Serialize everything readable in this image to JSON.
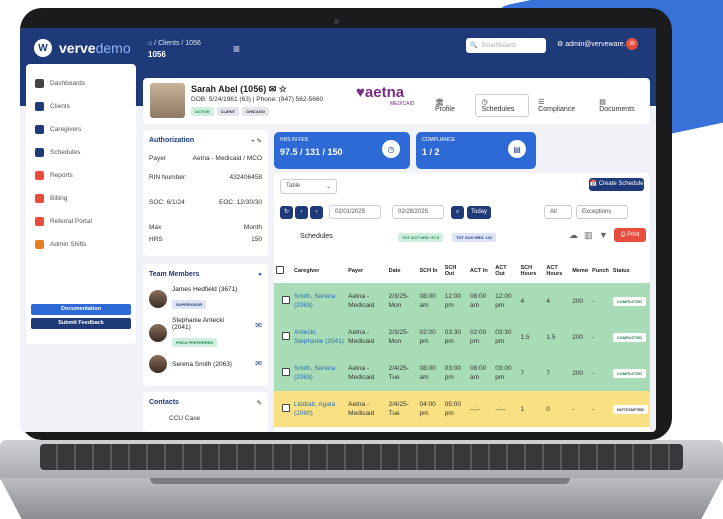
{
  "brand": {
    "verve": "verve",
    "demo": "demo"
  },
  "header": {
    "breadcrumb": "⌂ / Clients / 1056",
    "client_id": "1056",
    "search_placeholder": "SmartSearch",
    "user": "admin@verveware.co",
    "notif_count": "99"
  },
  "sidebar": {
    "items": [
      {
        "label": "Dashboards",
        "color": "#444"
      },
      {
        "label": "Clients",
        "color": "#1f3a78"
      },
      {
        "label": "Caregivers",
        "color": "#1f3a78"
      },
      {
        "label": "Schedules",
        "color": "#1f3a78"
      },
      {
        "label": "Reports",
        "color": "#e74c3c"
      },
      {
        "label": "Billing",
        "color": "#e74c3c"
      },
      {
        "label": "Referral Portal",
        "color": "#e74c3c"
      },
      {
        "label": "Admin Shifts",
        "color": "#e67e22"
      }
    ],
    "documentation": "Documentation",
    "feedback": "Submit Feedback"
  },
  "client": {
    "name": "Sarah Abel (1056)",
    "dob": "DOB: 5/24/1961 (63) | Phone: (847) 562-5660",
    "tags": [
      "ACTIVE",
      "CLIENT",
      "CHICAGO"
    ],
    "payer_logo": "♥aetna",
    "payer_sub": "MEDICAID",
    "tabs": [
      "Profile",
      "Schedules",
      "Compliance",
      "Documents"
    ]
  },
  "authorization": {
    "title": "Authorization",
    "payer_label": "Payer",
    "payer": "Aetna - Medicaid / MCO",
    "rin_label": "RIN Number:",
    "rin": "432406458",
    "soc": "SOC: 6/1/24",
    "eoc": "EOC: 12/30/30",
    "max_label": "Max",
    "max_val": "Month",
    "hrs_label": "HRS",
    "hrs_val": "150"
  },
  "team": {
    "title": "Team Members",
    "members": [
      {
        "name": "James Hedfield (3671)",
        "tag": "SUPERVISOR"
      },
      {
        "name": "Stephanie Antecki (2041)",
        "tag": "FMCA PREFERRED"
      },
      {
        "name": "Serena Smith (2063)",
        "tag": ""
      }
    ]
  },
  "contacts": {
    "title": "Contacts",
    "first": "CCU Case"
  },
  "stats": [
    {
      "label": "HRS IN FEB",
      "value": "97.5 / 131 / 150"
    },
    {
      "label": "COMPLIANCE",
      "value": "1 / 2"
    }
  ],
  "schedule": {
    "table_select": "Table",
    "date_from": "02/01/2025",
    "date_to": "02/28/2025",
    "today": "Today",
    "create": "Create Schedule",
    "all": "All",
    "exceptions": "Exceptions",
    "heading": "Schedules",
    "badge1": "TOT ACT HRS: 97.5",
    "badge2": "TOT SCH HRS: 121",
    "print": "Print",
    "columns": [
      "Caregiver",
      "Payer",
      "Date",
      "SCH In",
      "SCH Out",
      "ACT In",
      "ACT Out",
      "SCH Hours",
      "ACT Hours",
      "Memo",
      "Punch",
      "Status"
    ],
    "rows": [
      {
        "cls": "green",
        "cells": [
          "Smith, Serena (2063)",
          "Aetna - Medicaid",
          "2/3/25- Mon",
          "08:00 am",
          "12:00 pm",
          "08:00 am",
          "12:00 pm",
          "4",
          "4",
          "200",
          "-",
          "COMPLETED"
        ]
      },
      {
        "cls": "green",
        "cells": [
          "Antecki, Stephanie (2041)",
          "Aetna - Medicaid",
          "2/3/25- Mon",
          "02:00 pm",
          "03:30 pm",
          "02:00 pm",
          "03:30 pm",
          "1.5",
          "1.5",
          "200",
          "-",
          "COMPLETED"
        ]
      },
      {
        "cls": "green",
        "cells": [
          "Smith, Serena (2063)",
          "Aetna - Medicaid",
          "2/4/25- Tue",
          "08:00 am",
          "03:00 pm",
          "08:00 am",
          "03:00 pm",
          "7",
          "7",
          "200",
          "-",
          "COMPLETED"
        ]
      },
      {
        "cls": "yellow",
        "cells": [
          "Liddiatt, Agata (2060)",
          "Aetna - Medicaid",
          "2/4/25- Tue",
          "04:00 pm",
          "05:00 pm",
          "--:--",
          "--:--",
          "1",
          "0",
          "-",
          "-",
          "NOTSTARTED"
        ]
      }
    ]
  }
}
